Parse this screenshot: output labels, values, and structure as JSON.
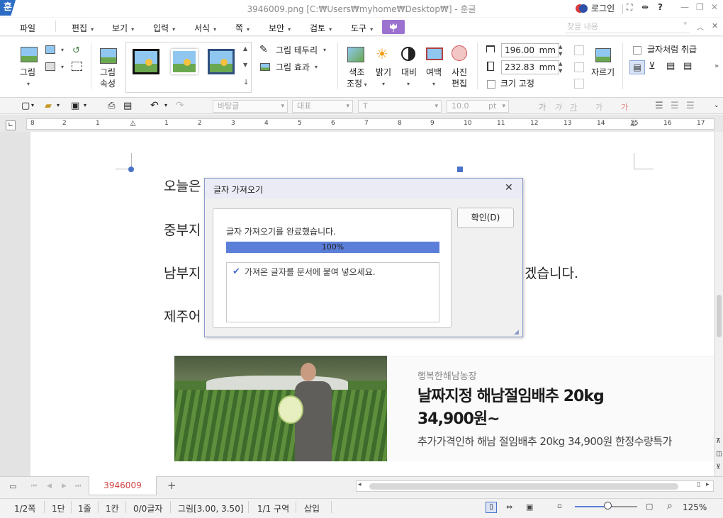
{
  "titlebar": {
    "app_icon": "훈",
    "window_title": "3946009.png [C:₩Users₩myhome₩Desktop₩] - 훈글",
    "login": "로그인",
    "icons": [
      "fullscreen-icon",
      "split-icon",
      "help-icon",
      "minimize-icon",
      "restore-icon",
      "close-icon"
    ]
  },
  "menu": {
    "items": [
      "파일",
      "편집",
      "보기",
      "입력",
      "서식",
      "쪽",
      "보안",
      "검토",
      "도구"
    ],
    "search_placeholder": "찾을 내용"
  },
  "ribbon": {
    "picture": "그림",
    "picture_props_1": "그림",
    "picture_props_2": "속성",
    "border": "그림 테두리",
    "effect": "그림 효과",
    "color_adjust_1": "색조",
    "color_adjust_2": "조정",
    "brightness": "밝기",
    "contrast": "대비",
    "margin": "여백",
    "photo_edit_1": "사진",
    "photo_edit_2": "편집",
    "width_value": "196.00",
    "height_value": "232.83",
    "unit": "mm",
    "fixed_size": "크기 고정",
    "crop": "자르기",
    "treat_as_char": "글자처럼 취급"
  },
  "toolbar2": {
    "style": "바탕글",
    "font_lang": "대표",
    "font": "T",
    "font_size": "10.0",
    "size_unit": "pt"
  },
  "ruler": {
    "numbers": [
      "8",
      "2",
      "1",
      "1",
      "2",
      "3",
      "4",
      "5",
      "6",
      "7",
      "8",
      "9",
      "10",
      "11",
      "12",
      "13",
      "14",
      "15",
      "16",
      "17"
    ]
  },
  "document": {
    "line1": "오늘은",
    "line2": "중부지",
    "line3": "남부지",
    "line3_tail": "겠습니다.",
    "line4": "제주어"
  },
  "banner": {
    "farm_name": "행복한해남농장",
    "title_line1": "날짜지정 해남절임배추 20kg",
    "title_line2": "34,900원~",
    "subtitle": "추가가격인하 해남 절임배추 20kg 34,900원 한정수량특가"
  },
  "dialog": {
    "title": "글자 가져오기",
    "message": "글자 가져오기를 완료했습니다.",
    "progress_percent": 100,
    "progress_text": "100%",
    "list_item": "가져온 글자를 문서에 붙여 넣으세요.",
    "ok_button": "확인(D)"
  },
  "tabs": {
    "doc_tab": "3946009"
  },
  "status": {
    "page": "1/2쪽",
    "section_col": "1단",
    "line": "1줄",
    "col": "1칸",
    "chars": "0/0글자",
    "picture_info": "그림[3.00, 3.50]",
    "area": "1/1 구역",
    "insert_mode": "삽입",
    "zoom": "125%"
  },
  "colors": {
    "accent": "#5b7fd9",
    "app_blue": "#2b6cc4",
    "tab_red": "#d04040",
    "menu_purple": "#9b72cf"
  }
}
